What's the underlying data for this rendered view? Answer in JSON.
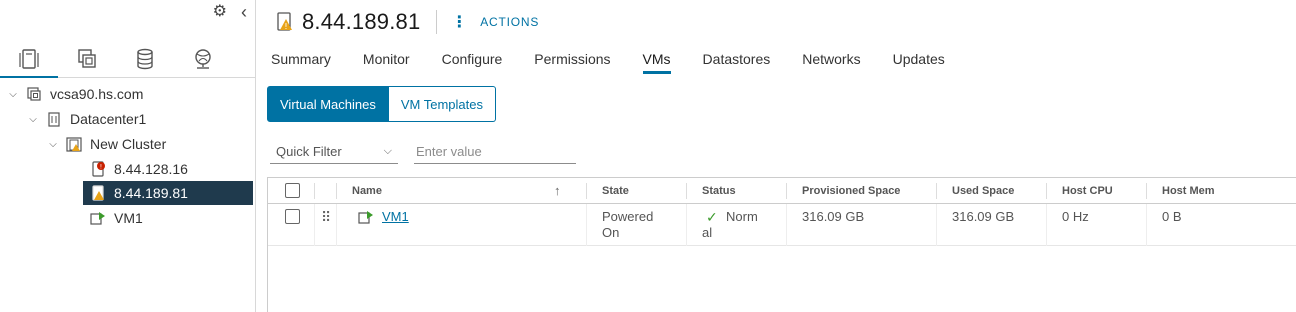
{
  "inventory": {
    "tree": [
      {
        "label": "vcsa90.hs.com"
      },
      {
        "label": "Datacenter1"
      },
      {
        "label": "New Cluster"
      },
      {
        "label": "8.44.128.16"
      },
      {
        "label": "8.44.189.81"
      },
      {
        "label": "VM1"
      }
    ]
  },
  "header": {
    "title": "8.44.189.81",
    "actions_label": "ACTIONS"
  },
  "tabs": [
    "Summary",
    "Monitor",
    "Configure",
    "Permissions",
    "VMs",
    "Datastores",
    "Networks",
    "Updates"
  ],
  "active_tab": "VMs",
  "view_toggle": {
    "virtual_machines": "Virtual Machines",
    "vm_templates": "VM Templates"
  },
  "filter": {
    "quick_filter": "Quick Filter",
    "placeholder": "Enter value"
  },
  "grid": {
    "columns": [
      "Name",
      "State",
      "Status",
      "Provisioned Space",
      "Used Space",
      "Host CPU",
      "Host Mem"
    ],
    "rows": [
      {
        "name": "VM1",
        "state_line1": "Powered",
        "state_line2": "On",
        "status_line1": "Norm",
        "status_line2": "al",
        "provisioned_space": "316.09 GB",
        "used_space": "316.09 GB",
        "host_cpu": "0 Hz",
        "host_mem": "0 B"
      }
    ]
  },
  "colors": {
    "accent": "#0072a3",
    "selected_node": "#1f3a4d",
    "warning": "#e8a317",
    "error": "#c92100",
    "vm_green": "#3b9b2b"
  }
}
